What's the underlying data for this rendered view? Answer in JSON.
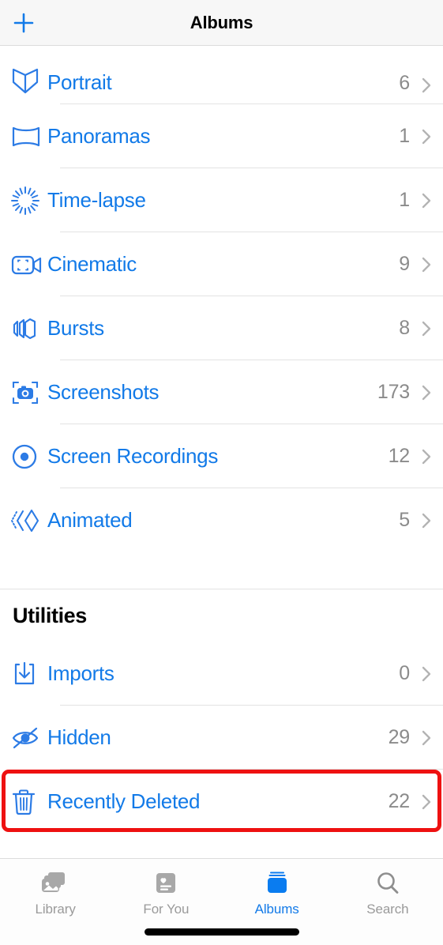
{
  "navbar": {
    "title": "Albums",
    "add_icon": "plus-icon",
    "accent_color": "#127ae8"
  },
  "colors": {
    "accent": "#127ae8",
    "count_text": "#8b8b8b",
    "highlight_border": "#ee1111",
    "separator": "#e3e3e3",
    "navbar_bg": "#f7f7f7",
    "tab_inactive": "#9a9a9a"
  },
  "media_types_section": {
    "items": [
      {
        "label": "Portrait",
        "count": "6",
        "icon": "portrait-icon"
      },
      {
        "label": "Panoramas",
        "count": "1",
        "icon": "panorama-icon"
      },
      {
        "label": "Time-lapse",
        "count": "1",
        "icon": "timelapse-icon"
      },
      {
        "label": "Cinematic",
        "count": "9",
        "icon": "cinematic-video-icon"
      },
      {
        "label": "Bursts",
        "count": "8",
        "icon": "bursts-icon"
      },
      {
        "label": "Screenshots",
        "count": "173",
        "icon": "screenshot-camera-icon"
      },
      {
        "label": "Screen Recordings",
        "count": "12",
        "icon": "record-circle-icon"
      },
      {
        "label": "Animated",
        "count": "5",
        "icon": "animated-chevron-icon"
      }
    ]
  },
  "utilities_section": {
    "header": "Utilities",
    "items": [
      {
        "label": "Imports",
        "count": "0",
        "icon": "import-download-icon",
        "highlighted": false
      },
      {
        "label": "Hidden",
        "count": "29",
        "icon": "eye-slash-icon",
        "highlighted": false
      },
      {
        "label": "Recently Deleted",
        "count": "22",
        "icon": "trash-icon",
        "highlighted": true
      }
    ]
  },
  "tabbar": {
    "tabs": [
      {
        "label": "Library",
        "icon": "photo-stack-icon",
        "active": false
      },
      {
        "label": "For You",
        "icon": "heart-card-icon",
        "active": false
      },
      {
        "label": "Albums",
        "icon": "albums-books-icon",
        "active": true
      },
      {
        "label": "Search",
        "icon": "search-icon",
        "active": false
      }
    ]
  },
  "home_indicator": "home-indicator"
}
